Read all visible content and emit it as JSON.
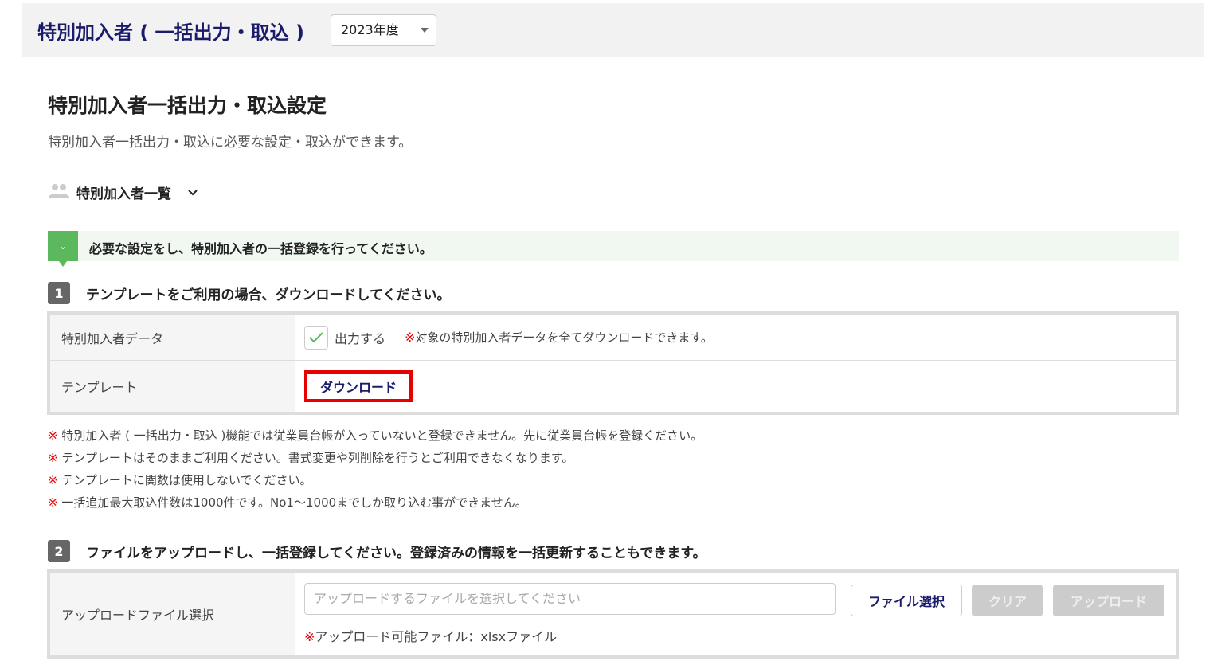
{
  "header": {
    "title": "特別加入者 ( 一括出力・取込 )",
    "year": "2023年度"
  },
  "page": {
    "title": "特別加入者一括出力・取込設定",
    "description": "特別加入者一括出力・取込に必要な設定・取込ができます。"
  },
  "toggle": {
    "label": "特別加入者一覧"
  },
  "banner": {
    "text": "必要な設定をし、特別加入者の一括登録を行ってください。"
  },
  "step1": {
    "number": "1",
    "text": "テンプレートをご利用の場合、ダウンロードしてください。",
    "rows": [
      {
        "label": "特別加入者データ",
        "checkbox_label": "出力する",
        "note_mark": "※",
        "note": "対象の特別加入者データを全てダウンロードできます。"
      },
      {
        "label": "テンプレート",
        "button": "ダウンロード"
      }
    ]
  },
  "notes": [
    {
      "mark": "※",
      "text": "特別加入者 ( 一括出力・取込 )機能では従業員台帳が入っていないと登録できません。先に従業員台帳を登録ください。"
    },
    {
      "mark": "※",
      "text": "テンプレートはそのままご利用ください。書式変更や列削除を行うとご利用できなくなります。"
    },
    {
      "mark": "※",
      "text": "テンプレートに関数は使用しないでください。"
    },
    {
      "mark": "※",
      "text": "一括追加最大取込件数は1000件です。No1～1000までしか取り込む事ができません。"
    }
  ],
  "step2": {
    "number": "2",
    "text": "ファイルをアップロードし、一括登録してください。登録済みの情報を一括更新することもできます。",
    "label": "アップロードファイル選択",
    "placeholder": "アップロードするファイルを選択してください",
    "select_button": "ファイル選択",
    "clear_button": "クリア",
    "upload_button": "アップロード",
    "note_mark": "※",
    "note": "アップロード可能ファイル：xlsxファイル"
  }
}
